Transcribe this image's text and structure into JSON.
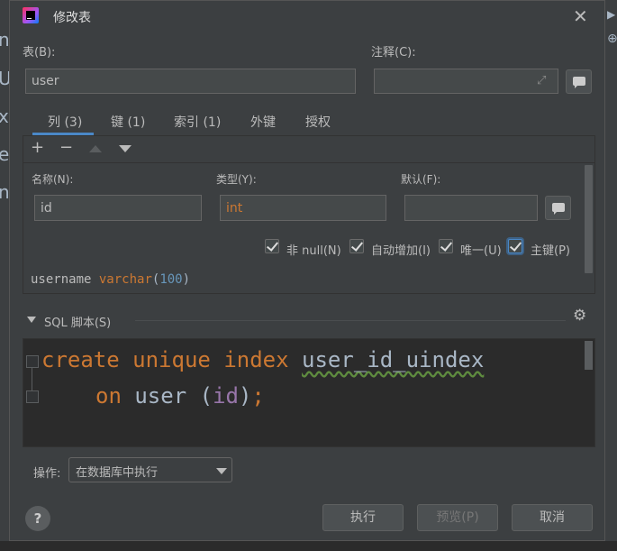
{
  "window": {
    "title": "修改表"
  },
  "background_fragments": [
    "n",
    "U",
    "x",
    "e",
    "n"
  ],
  "table": {
    "label": "表(B):",
    "value": "user"
  },
  "comment": {
    "label": "注释(C):",
    "value": ""
  },
  "tabs": [
    {
      "label": "列 (3)",
      "active": true
    },
    {
      "label": "键 (1)",
      "active": false
    },
    {
      "label": "索引 (1)",
      "active": false
    },
    {
      "label": "外键",
      "active": false
    },
    {
      "label": "授权",
      "active": false
    }
  ],
  "toolbar": {
    "add": "+",
    "remove": "−"
  },
  "column": {
    "name_label": "名称(N):",
    "name_value": "id",
    "type_label": "类型(Y):",
    "type_value": "int",
    "default_label": "默认(F):",
    "default_value": ""
  },
  "checkboxes": [
    {
      "label": "非 null(N)",
      "checked": true
    },
    {
      "label": "自动增加(I)",
      "checked": true
    },
    {
      "label": "唯一(U)",
      "checked": true
    },
    {
      "label": "主键(P)",
      "checked": true
    }
  ],
  "next_column": {
    "name": "username",
    "type": "varchar",
    "open": "(",
    "size": "100",
    "close": ")"
  },
  "sql": {
    "section_label": "SQL 脚本(S)",
    "line1": {
      "kw1": "create",
      "kw2": "unique",
      "kw3": "index",
      "name": "user_id_uindex"
    },
    "line2": {
      "kw": "on",
      "table": "user",
      "open": "(",
      "field": "id",
      "close": ")",
      "semi": ";"
    }
  },
  "operation": {
    "label": "操作:",
    "value": "在数据库中执行"
  },
  "buttons": {
    "execute": "执行",
    "preview": "预览(P)",
    "cancel": "取消",
    "help": "?"
  },
  "colors": {
    "accent": "#4a88c7",
    "keyword": "#cc7832",
    "field": "#9876aa"
  }
}
